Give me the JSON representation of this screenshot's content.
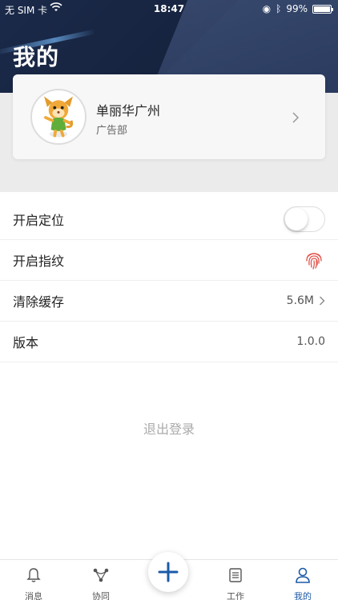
{
  "status_bar": {
    "carrier": "无 SIM 卡",
    "time": "18:47",
    "battery": "99%",
    "battery_level": 0.99
  },
  "header": {
    "title": "我的"
  },
  "profile": {
    "name": "单丽华广州",
    "department": "广告部"
  },
  "settings": [
    {
      "label": "开启定位",
      "control": "toggle",
      "toggle_on": false
    },
    {
      "label": "开启指纹",
      "control": "fingerprint-icon"
    },
    {
      "label": "清除缓存",
      "value": "5.6M"
    },
    {
      "label": "版本",
      "value": "1.0.0"
    }
  ],
  "logout_label": "退出登录",
  "tabs": [
    {
      "label": "消息",
      "icon": "bell-icon"
    },
    {
      "label": "协同",
      "icon": "collaborate-icon"
    },
    {
      "label": "工作",
      "icon": "document-icon"
    },
    {
      "label": "我的",
      "icon": "user-icon",
      "active": true
    }
  ],
  "colors": {
    "accent": "#1b5aa8",
    "header_bg": "#1b2a4a"
  }
}
